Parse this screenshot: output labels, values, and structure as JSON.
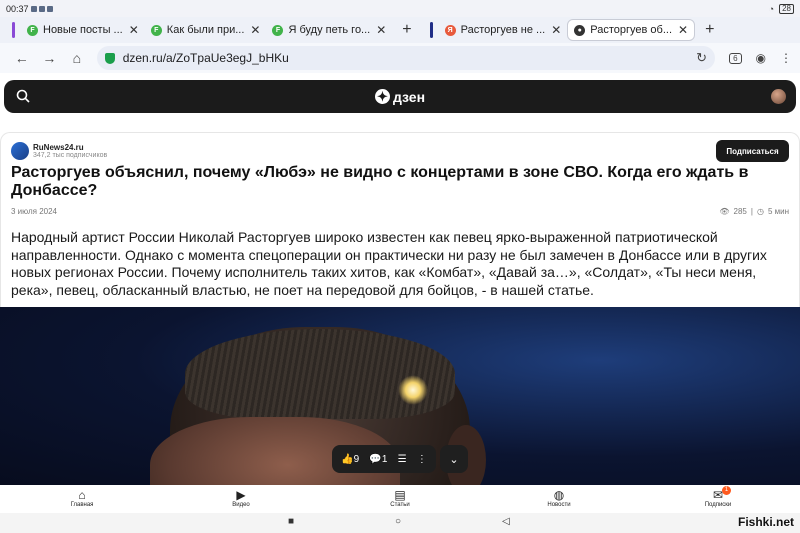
{
  "status": {
    "time": "00:37",
    "battery": "28"
  },
  "tabs": [
    {
      "label": "Новые посты ...",
      "favicon": "F",
      "color": "#41b34a",
      "active": false
    },
    {
      "label": "Как были при...",
      "favicon": "F",
      "color": "#41b34a",
      "active": false
    },
    {
      "label": "Я буду петь го...",
      "favicon": "F",
      "color": "#41b34a",
      "active": false
    },
    {
      "label": "Расторгуев не ...",
      "favicon": "Я",
      "color": "#e85a3c",
      "active": false
    },
    {
      "label": "Расторгуев об...",
      "favicon": "",
      "color": "#333333",
      "active": true
    }
  ],
  "url": "dzen.ru/a/ZoTpaUe3egJ_bHKu",
  "tab_count": "6",
  "brand": "дзен",
  "article": {
    "publisher": "RuNews24.ru",
    "subscribers": "347,2 тыс подписчиков",
    "subscribe_label": "Подписаться",
    "title": "Расторгуев объяснил, почему «Любэ» не видно с концертами в зоне СВО. Когда его ждать в Донбассе?",
    "date": "3 июля 2024",
    "views": "285",
    "read_time": "5 мин",
    "lead": "Народный артист России Николай Расторгуев широко известен как певец ярко-выраженной патриотической направленности. Однако с момента спецоперации он практически ни разу не был замечен в Донбассе или в других новых регионах России. Почему исполнитель таких хитов, как «Комбат», «Давай за…», «Солдат», «Ты неси меня, река», певец, обласканный властью, не поет на передовой для бойцов, - в нашей статье."
  },
  "floating": {
    "likes": "9",
    "comments": "1"
  },
  "bottom_nav": [
    {
      "label": "Главная",
      "icon": "home-icon"
    },
    {
      "label": "Видео",
      "icon": "video-icon"
    },
    {
      "label": "Статьи",
      "icon": "book-icon"
    },
    {
      "label": "Новости",
      "icon": "news-icon"
    },
    {
      "label": "Подписки",
      "icon": "subscriptions-icon",
      "badge": "1"
    }
  ],
  "watermark": "Fishki.net"
}
